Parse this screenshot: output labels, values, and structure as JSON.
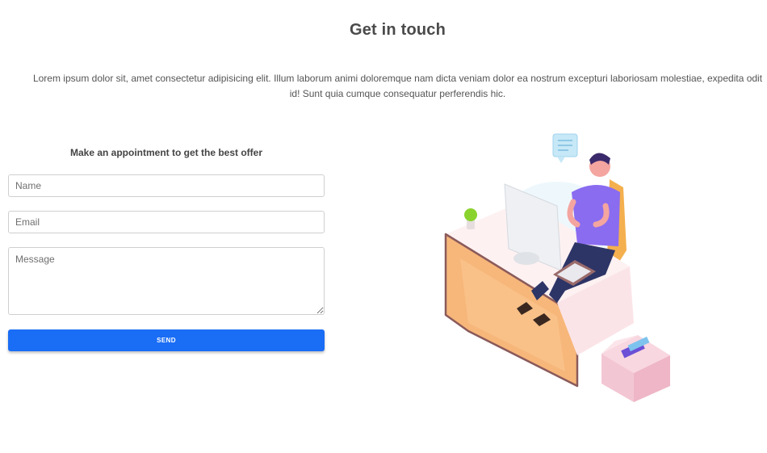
{
  "header": {
    "title": "Get in touch",
    "intro": "Lorem ipsum dolor sit, amet consectetur adipisicing elit. Illum laborum animi doloremque nam dicta veniam dolor ea nostrum excepturi laboriosam molestiae, expedita odit id! Sunt quia cumque consequatur perferendis hic."
  },
  "form": {
    "heading": "Make an appointment to get the best offer",
    "name_placeholder": "Name",
    "email_placeholder": "Email",
    "message_placeholder": "Message",
    "send_label": "SEND"
  },
  "colors": {
    "accent": "#1a6df5",
    "desk": "#f7b77a",
    "shirt": "#8a6cf0",
    "box": "#f3c6d3"
  }
}
